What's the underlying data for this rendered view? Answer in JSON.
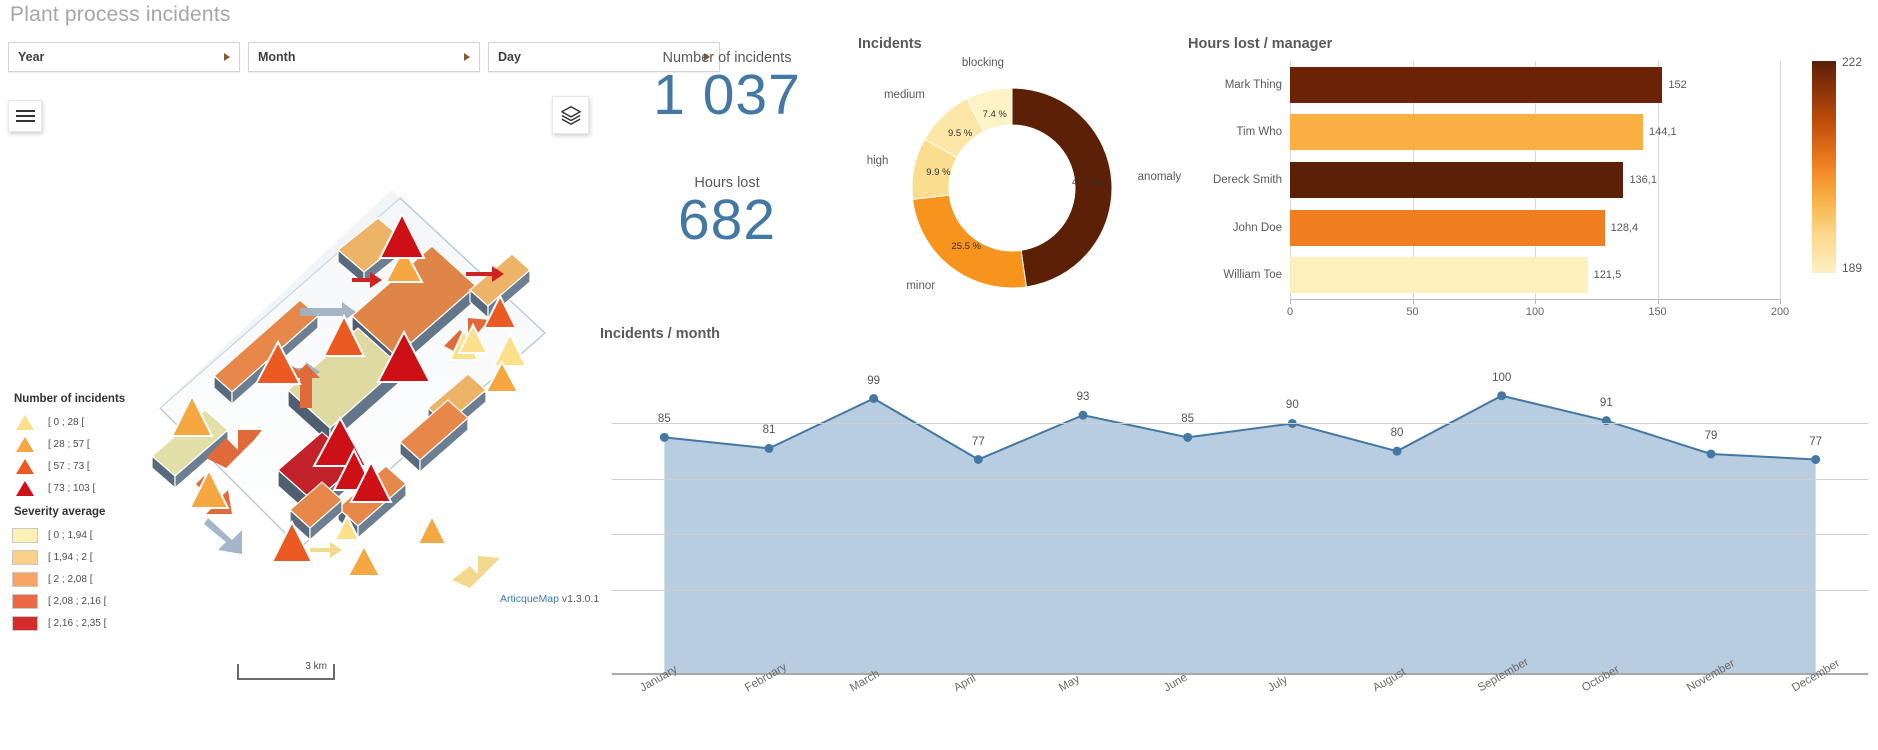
{
  "header": {
    "title": "Plant process incidents",
    "filters": [
      {
        "label": "Year",
        "icon": "chevron-right-icon"
      },
      {
        "label": "Month",
        "icon": "chevron-right-icon"
      },
      {
        "label": "Day",
        "icon": "chevron-right-icon"
      }
    ]
  },
  "map": {
    "menu_icon": "hamburger-menu-icon",
    "layers_icon": "layers-icon",
    "scale_label": "3 km",
    "attribution_brand": "ArticqueMap",
    "attribution_version": "v1.3.0.1",
    "legend_incidents": {
      "title": "Number of incidents",
      "items": [
        {
          "label": "[ 0 ; 28 [",
          "color": "#fde9a0"
        },
        {
          "label": "[ 28 ; 57 [",
          "color": "#f9a council"
        },
        {
          "label": "[ 57 ; 73 [",
          "color": "#ec5a24"
        },
        {
          "label": "[ 73 ; 103 [",
          "color": "#cc1016"
        }
      ]
    },
    "legend_severity": {
      "title": "Severity average",
      "items": [
        {
          "label": "[ 0 ; 1,94 [",
          "color": "#fcf0b4"
        },
        {
          "label": "[ 1,94 ; 2 [",
          "color": "#fbd08a"
        },
        {
          "label": "[ 2 ; 2,08 [",
          "color": "#f7a濃65"
        },
        {
          "label": "[ 2,08 ; 2,16 [",
          "color": "#ea6a45"
        },
        {
          "label": "[ 2,16 ; 2,35 [",
          "color": "#d62b2b"
        }
      ]
    }
  },
  "kpis": [
    {
      "caption": "Number of incidents",
      "value": "1 037"
    },
    {
      "caption": "Hours lost",
      "value": "682"
    }
  ],
  "chart_data": [
    {
      "type": "pie",
      "title": "Incidents",
      "legend_position": "outside-labels",
      "labels": [
        "anomaly",
        "minor",
        "high",
        "medium",
        "blocking"
      ],
      "values": [
        47.7,
        25.5,
        9.9,
        9.5,
        7.4
      ],
      "value_labels": [
        "47.7 %",
        "25.5 %",
        "9.9 %",
        "9.5 %",
        "7.4 %"
      ],
      "colors": [
        "#5b2006",
        "#f7941e",
        "#fbdd8f",
        "#fce7a8",
        "#fdf3c6"
      ]
    },
    {
      "type": "bar",
      "title": "Hours lost / manager",
      "orientation": "horizontal",
      "categories": [
        "Mark Thing",
        "Tim Who",
        "Dereck Smith",
        "John Doe",
        "William Toe"
      ],
      "values": [
        152,
        144.1,
        136.1,
        128.4,
        121.5
      ],
      "value_labels": [
        "152",
        "144,1",
        "136,1",
        "128,4",
        "121,5"
      ],
      "colors": [
        "#6b2206",
        "#fbae41",
        "#5b2006",
        "#ef7e20",
        "#fdf0bd"
      ],
      "xlabel": "",
      "ylabel": "",
      "xlim": [
        0,
        200
      ],
      "xticks": [
        0,
        50,
        100,
        150,
        200
      ],
      "xtick_labels": [
        "0",
        "50",
        "100",
        "150",
        "200"
      ],
      "grid": true,
      "colorbar": {
        "max": "222",
        "min": "189"
      }
    },
    {
      "type": "area",
      "title": "Incidents / month",
      "categories": [
        "January",
        "February",
        "March",
        "April",
        "May",
        "June",
        "July",
        "August",
        "September",
        "October",
        "November",
        "December"
      ],
      "values": [
        85,
        81,
        99,
        77,
        93,
        85,
        90,
        80,
        100,
        91,
        79,
        77
      ],
      "xlabel": "",
      "ylabel": "",
      "ylim": [
        0,
        110
      ],
      "grid": true,
      "line_color": "#4377a4",
      "fill_color": "#b9cde0"
    }
  ]
}
